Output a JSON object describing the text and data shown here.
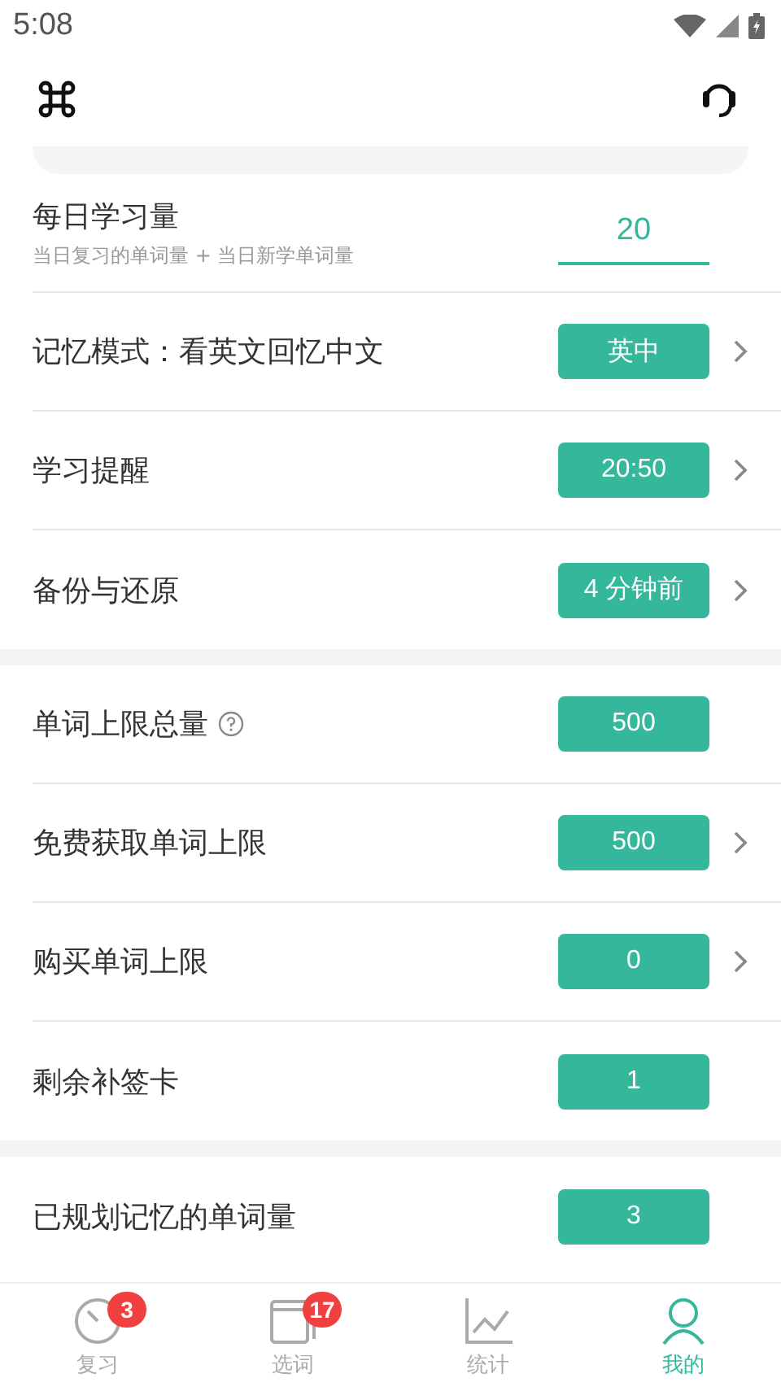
{
  "status_bar": {
    "time": "5:08"
  },
  "sections": [
    {
      "rows": [
        {
          "kind": "input",
          "label": "每日学习量",
          "sublabel": "当日复习的单词量 + 当日新学单词量",
          "value": "20",
          "chevron": false,
          "help": false
        },
        {
          "kind": "pill",
          "label": "记忆模式：看英文回忆中文",
          "value": "英中",
          "chevron": true,
          "help": false
        },
        {
          "kind": "pill",
          "label": "学习提醒",
          "value": "20:50",
          "chevron": true,
          "help": false
        },
        {
          "kind": "pill",
          "label": "备份与还原",
          "value": "4 分钟前",
          "chevron": true,
          "help": false
        }
      ]
    },
    {
      "rows": [
        {
          "kind": "pill",
          "label": "单词上限总量",
          "value": "500",
          "chevron": false,
          "help": true
        },
        {
          "kind": "pill",
          "label": "免费获取单词上限",
          "value": "500",
          "chevron": true,
          "help": false
        },
        {
          "kind": "pill",
          "label": "购买单词上限",
          "value": "0",
          "chevron": true,
          "help": false
        },
        {
          "kind": "pill",
          "label": "剩余补签卡",
          "value": "1",
          "chevron": false,
          "help": false
        }
      ]
    },
    {
      "rows": [
        {
          "kind": "pill",
          "label": "已规划记忆的单词量",
          "value": "3",
          "chevron": false,
          "help": false
        }
      ]
    }
  ],
  "tabs": [
    {
      "label": "复习",
      "badge": "3",
      "selected": false
    },
    {
      "label": "选词",
      "badge": "17",
      "selected": false
    },
    {
      "label": "统计",
      "selected": false
    },
    {
      "label": "我的",
      "selected": true
    }
  ]
}
